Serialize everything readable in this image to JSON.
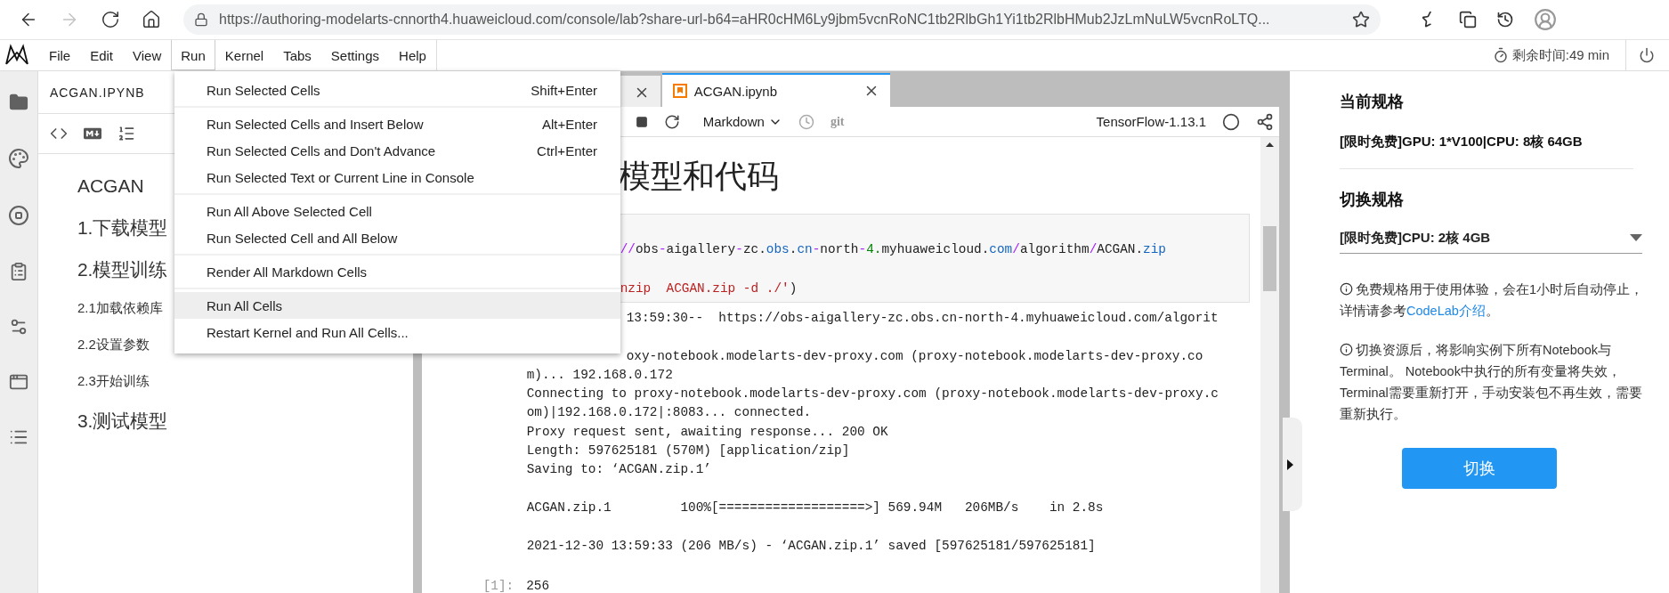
{
  "browser": {
    "nav": [
      {
        "kind": "back",
        "disabled": false
      },
      {
        "kind": "forward",
        "disabled": true
      },
      {
        "kind": "reload",
        "disabled": false
      },
      {
        "kind": "home",
        "disabled": false
      }
    ],
    "url": "https://authoring-modelarts-cnnorth4.huaweicloud.com/console/lab?share-url-b64=aHR0cHM6Ly9jbm5vcnRoNC1tb2RlbGh1Yi1tb2RlbHMub2JzLmNuLW5vcnRoLTQ..."
  },
  "menubar": {
    "items": [
      {
        "label": "File",
        "selected": false
      },
      {
        "label": "Edit",
        "selected": false
      },
      {
        "label": "View",
        "selected": false
      },
      {
        "label": "Run",
        "selected": true
      },
      {
        "label": "Kernel",
        "selected": false
      },
      {
        "label": "Tabs",
        "selected": false
      },
      {
        "label": "Settings",
        "selected": false
      },
      {
        "label": "Help",
        "selected": false
      }
    ],
    "timer": "剩余时间:49 min"
  },
  "run_menu": {
    "groups": [
      {
        "items": [
          {
            "label": "Run Selected Cells",
            "shortcut": "Shift+Enter",
            "highlighted": false
          }
        ]
      },
      {
        "items": [
          {
            "label": "Run Selected Cells and Insert Below",
            "shortcut": "Alt+Enter",
            "highlighted": false
          },
          {
            "label": "Run Selected Cells and Don't Advance",
            "shortcut": "Ctrl+Enter",
            "highlighted": false
          },
          {
            "label": "Run Selected Text or Current Line in Console",
            "highlighted": false
          }
        ]
      },
      {
        "items": [
          {
            "label": "Run All Above Selected Cell",
            "highlighted": false
          },
          {
            "label": "Run Selected Cell and All Below",
            "highlighted": false
          }
        ]
      },
      {
        "items": [
          {
            "label": "Render All Markdown Cells",
            "highlighted": false
          }
        ]
      },
      {
        "items": [
          {
            "label": "Run All Cells",
            "highlighted": true
          },
          {
            "label": "Restart Kernel and Run All Cells...",
            "highlighted": false
          }
        ]
      }
    ]
  },
  "left_panel": {
    "title": "ACGAN.IPYNB",
    "toc": [
      {
        "text": "ACGAN"
      },
      {
        "text": "1.下载模型"
      },
      {
        "text": "2.模型训练",
        "children": [
          {
            "text": "2.1加载依赖库"
          },
          {
            "text": "2.2设置参数"
          },
          {
            "text": "2.3开始训练"
          }
        ]
      },
      {
        "text": "3.测试模型"
      }
    ]
  },
  "notebook": {
    "tabs": [
      {
        "selected": false
      },
      {
        "label": "ACGAN.ipynb",
        "selected": true
      }
    ],
    "toolbar": {
      "cell_type": "Markdown",
      "git": "git",
      "kernel": "TensorFlow-1.13.1"
    },
    "heading": "模型和代码",
    "code_lines": [
      [
        {
          "text": "//",
          "kind": "op"
        },
        {
          "text": "obs",
          "kind": "plain"
        },
        {
          "text": "-",
          "kind": "op"
        },
        {
          "text": "aigallery",
          "kind": "plain"
        },
        {
          "text": "-",
          "kind": "op"
        },
        {
          "text": "zc.",
          "kind": "plain"
        },
        {
          "text": "obs",
          "kind": "attr"
        },
        {
          "text": ".",
          "kind": "plain"
        },
        {
          "text": "cn",
          "kind": "attr"
        },
        {
          "text": "-",
          "kind": "op"
        },
        {
          "text": "north",
          "kind": "plain"
        },
        {
          "text": "-",
          "kind": "op"
        },
        {
          "text": "4.",
          "kind": "number"
        },
        {
          "text": "myhuaweicloud.",
          "kind": "plain"
        },
        {
          "text": "com",
          "kind": "attr"
        },
        {
          "text": "/",
          "kind": "op"
        },
        {
          "text": "algorithm",
          "kind": "plain"
        },
        {
          "text": "/",
          "kind": "op"
        },
        {
          "text": "ACGAN.",
          "kind": "plain"
        },
        {
          "text": "zip",
          "kind": "attr"
        }
      ],
      [
        {
          "text": "nzip  ACGAN.zip -d ./'",
          "kind": "string"
        },
        {
          "text": ")",
          "kind": "plain"
        }
      ]
    ],
    "output": [
      {
        "text": "13:59:30--  https://obs-aigallery-zc.obs.cn-north-4.myhuaweicloud.com/algorit",
        "kind": "clipped"
      },
      {
        "text": "oxy-notebook.modelarts-dev-proxy.com (proxy-notebook.modelarts-dev-proxy.co",
        "kind": "clipped",
        "gap_before": true
      },
      {
        "text": "m)... 192.168.0.172",
        "kind": "line"
      },
      {
        "text": "Connecting to proxy-notebook.modelarts-dev-proxy.com (proxy-notebook.modelarts-dev-proxy.c",
        "kind": "line"
      },
      {
        "text": "om)|192.168.0.172|:8083... connected.",
        "kind": "line"
      },
      {
        "text": "Proxy request sent, awaiting response... 200 OK",
        "kind": "line"
      },
      {
        "text": "Length: 597625181 (570M) [application/zip]",
        "kind": "line"
      },
      {
        "text": "Saving to: ‘ACGAN.zip.1’",
        "kind": "line"
      },
      {
        "text": "ACGAN.zip.1         100%[===================>] 569.94M   206MB/s    in 2.8s",
        "kind": "line",
        "gap_before": true
      },
      {
        "text": "2021-12-30 13:59:33 (206 MB/s) - ‘ACGAN.zip.1’ saved [597625181/597625181]",
        "kind": "line",
        "gap_before": true
      }
    ],
    "result": {
      "prompt": "[1]:",
      "value": "256"
    }
  },
  "right_panel": {
    "current_title": "当前规格",
    "current_spec": "[限时免费]GPU: 1*V100|CPU: 8核 64GB",
    "switch_title": "切换规格",
    "select_value": "[限时免费]CPU: 2核 4GB",
    "notes": [
      {
        "text": "免费规格用于使用体验，会在1小时后自动停止，详情请参考",
        "link": "CodeLab介绍",
        "after": "。"
      },
      {
        "text": "切换资源后，将影响实例下所有Notebook与Terminal。 Notebook中执行的所有变量将失效，Terminal需要重新打开，手动安装包不再生效，需要重新执行。"
      }
    ],
    "button": "切换"
  }
}
